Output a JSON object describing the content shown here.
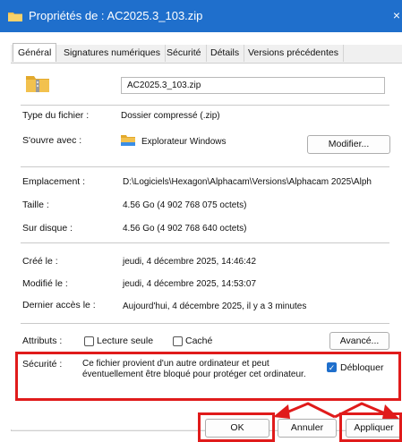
{
  "window": {
    "title": "Propriétés de : AC2025.3_103.zip",
    "close_glyph": "×"
  },
  "tabs": [
    {
      "label": "Général",
      "active": true
    },
    {
      "label": "Signatures numériques"
    },
    {
      "label": "Sécurité"
    },
    {
      "label": "Détails"
    },
    {
      "label": "Versions précédentes"
    }
  ],
  "file": {
    "name": "AC2025.3_103.zip",
    "icon": "zip-folder-icon"
  },
  "props": {
    "type_label": "Type du fichier :",
    "type_value": "Dossier compressé (.zip)",
    "opens_label": "S'ouvre avec :",
    "opens_value": "Explorateur Windows",
    "opens_icon": "folder-icon",
    "modify_button": "Modifier...",
    "location_label": "Emplacement :",
    "location_value": "D:\\Logiciels\\Hexagon\\Alphacam\\Versions\\Alphacam 2025\\Alph",
    "size_label": "Taille :",
    "size_value": "4.56 Go (4 902 768 075 octets)",
    "disk_label": "Sur disque :",
    "disk_value": "4.56 Go (4 902 768 640 octets)",
    "created_label": "Créé le :",
    "created_value": "jeudi, 4 décembre 2025, 14:46:42",
    "modified_label": "Modifié le :",
    "modified_value": "jeudi, 4 décembre 2025, 14:53:07",
    "accessed_label": "Dernier accès le :",
    "accessed_value": "Aujourd'hui, 4 décembre 2025, il y a 3 minutes",
    "attributes_label": "Attributs :",
    "readonly_label": "Lecture seule",
    "hidden_label": "Caché",
    "advanced_button": "Avancé...",
    "security_label": "Sécurité :",
    "security_line1": "Ce fichier provient d'un autre ordinateur et peut",
    "security_line2": "éventuellement être bloqué pour protéger cet ordinateur.",
    "unblock_label": "Débloquer",
    "check_glyph": "✓"
  },
  "buttons": {
    "ok": "OK",
    "cancel": "Annuler",
    "apply": "Appliquer"
  },
  "colors": {
    "title_bar": "#1f6fcc",
    "highlight": "#e01b1b",
    "folder": "#f2c14e"
  }
}
